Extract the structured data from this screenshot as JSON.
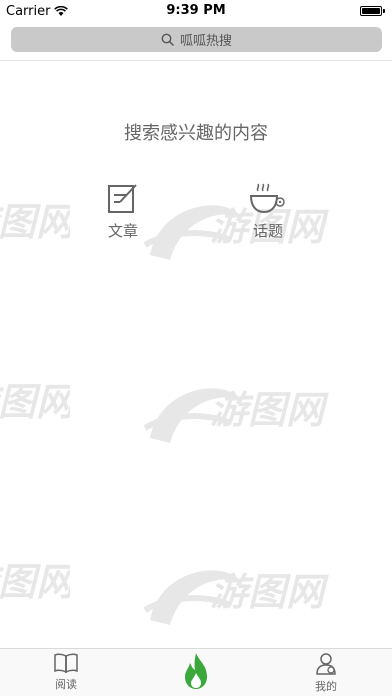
{
  "status_bar": {
    "carrier": "Carrier",
    "time": "9:39 PM"
  },
  "search": {
    "placeholder": "呱呱热搜"
  },
  "main": {
    "prompt": "搜索感兴趣的内容",
    "categories": [
      {
        "label": "文章",
        "icon": "article-icon"
      },
      {
        "label": "话题",
        "icon": "coffee-cup-icon"
      }
    ]
  },
  "watermark": {
    "text": "游图网"
  },
  "tab_bar": {
    "items": [
      {
        "label": "阅读",
        "icon": "book-icon"
      },
      {
        "label": "",
        "icon": "flame-icon",
        "active_color": "#3aa83a"
      },
      {
        "label": "我的",
        "icon": "user-icon"
      }
    ]
  },
  "colors": {
    "search_bg": "#c9c9c9",
    "accent_green": "#3aa83a",
    "text_gray": "#666666"
  }
}
